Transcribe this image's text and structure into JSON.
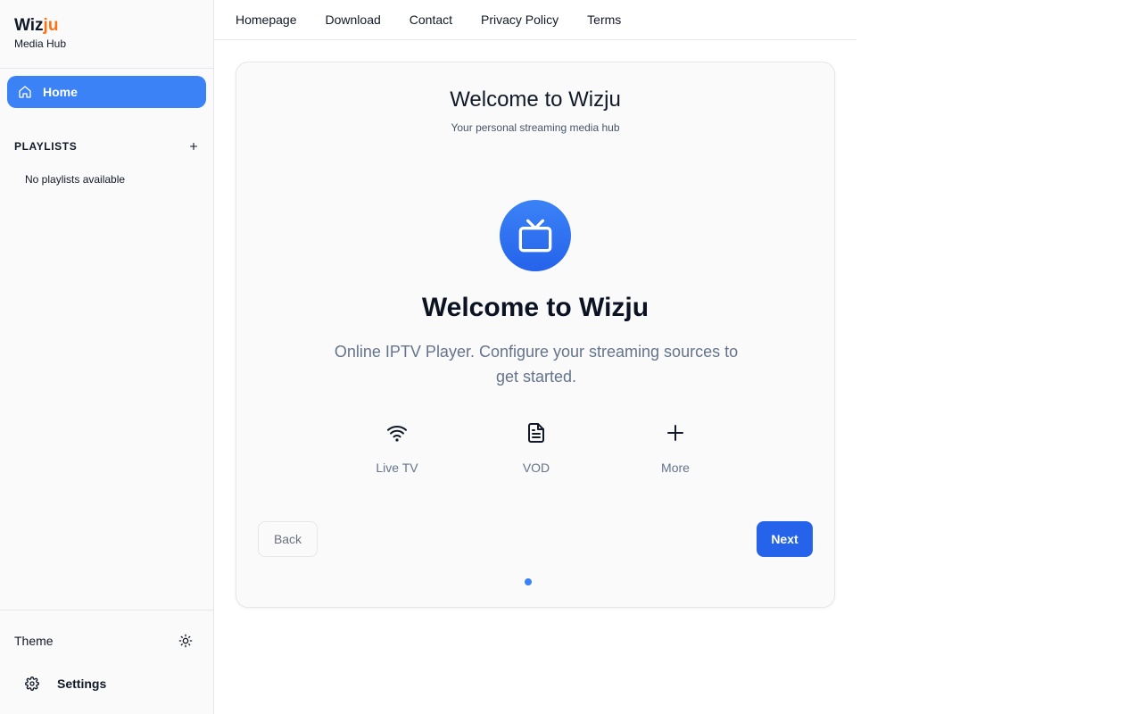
{
  "brand": {
    "name_main": "Wiz",
    "name_accent": "ju",
    "subtitle": "Media Hub"
  },
  "sidebar": {
    "home_label": "Home",
    "playlists_title": "PLAYLISTS",
    "playlists_empty": "No playlists available",
    "theme_label": "Theme",
    "settings_label": "Settings"
  },
  "topnav": {
    "items": [
      "Homepage",
      "Download",
      "Contact",
      "Privacy Policy",
      "Terms"
    ]
  },
  "card": {
    "title": "Welcome to Wizju",
    "subtitle": "Your personal streaming media hub",
    "hero_title": "Welcome to Wizju",
    "hero_description": "Online IPTV Player. Configure your streaming sources to get started.",
    "features": [
      {
        "label": "Live TV",
        "icon": "wifi-icon"
      },
      {
        "label": "VOD",
        "icon": "document-icon"
      },
      {
        "label": "More",
        "icon": "plus-icon"
      }
    ],
    "back_label": "Back",
    "next_label": "Next",
    "step_count": 1,
    "current_step": 1
  },
  "colors": {
    "accent": "#3b82f6",
    "brand_accent": "#f97316",
    "primary_button": "#2563eb"
  }
}
